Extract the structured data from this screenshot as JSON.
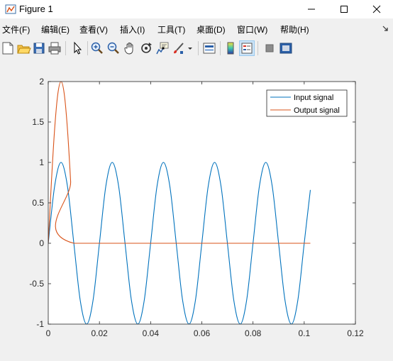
{
  "window": {
    "title": "Figure 1",
    "icon": "matlab-figure-icon",
    "controls": [
      "minimize-icon",
      "maximize-icon",
      "close-icon"
    ]
  },
  "menubar": {
    "items": [
      {
        "label": "文件(F)"
      },
      {
        "label": "编辑(E)"
      },
      {
        "label": "查看(V)"
      },
      {
        "label": "插入(I)"
      },
      {
        "label": "工具(T)"
      },
      {
        "label": "桌面(D)"
      },
      {
        "label": "窗口(W)"
      },
      {
        "label": "帮助(H)"
      }
    ],
    "dock_icon": "dock-arrow-icon"
  },
  "toolbar": {
    "buttons": [
      "new-figure-icon",
      "open-file-icon",
      "save-icon",
      "print-icon",
      "edit-plot-arrow-icon",
      "zoom-in-icon",
      "zoom-out-icon",
      "pan-hand-icon",
      "rotate-3d-icon",
      "data-cursor-icon",
      "brush-icon",
      "link-plot-icon",
      "colorbar-icon",
      "legend-icon",
      "hide-plot-tools-icon",
      "show-plot-tools-icon"
    ],
    "pressed": "legend-icon"
  },
  "chart_data": {
    "type": "line",
    "title": "",
    "xlabel": "",
    "ylabel": "",
    "xlim": [
      0,
      0.12
    ],
    "ylim": [
      -1,
      2
    ],
    "xticks": [
      "0",
      "0.02",
      "0.04",
      "0.06",
      "0.08",
      "0.1",
      "0.12"
    ],
    "yticks": [
      "-1",
      "-0.5",
      "0",
      "0.5",
      "1",
      "1.5",
      "2"
    ],
    "grid": false,
    "legend_position": "top-right",
    "series": [
      {
        "name": "Input signal",
        "color": "#0072bd",
        "x": [
          0,
          0.0025,
          0.005,
          0.0075,
          0.01,
          0.0125,
          0.015,
          0.0175,
          0.02,
          0.0225,
          0.025,
          0.0275,
          0.03,
          0.0325,
          0.035,
          0.0375,
          0.04,
          0.0425,
          0.045,
          0.0475,
          0.05,
          0.0525,
          0.055,
          0.0575,
          0.06,
          0.0625,
          0.065,
          0.0675,
          0.07,
          0.0725,
          0.075,
          0.0775,
          0.08,
          0.0825,
          0.085,
          0.0875,
          0.09,
          0.0925,
          0.095,
          0.0975,
          0.1,
          0.1024
        ],
        "y": [
          0,
          0.707,
          1,
          0.707,
          0,
          -0.707,
          -1,
          -0.707,
          0,
          0.707,
          1,
          0.707,
          0,
          -0.707,
          -1,
          -0.707,
          0,
          0.707,
          1,
          0.707,
          0,
          -0.707,
          -1,
          -0.707,
          0,
          0.707,
          1,
          0.707,
          0,
          -0.707,
          -1,
          -0.707,
          0,
          0.707,
          1,
          0.707,
          0,
          -0.707,
          -1,
          -0.707,
          0,
          0.66
        ]
      },
      {
        "name": "Output signal",
        "color": "#d95319",
        "x": [
          0,
          0.00125,
          0.0025,
          0.00375,
          0.005,
          0.00625,
          0.0075,
          0.00875,
          0.01,
          0.1024
        ],
        "y": [
          0,
          0.765,
          1.414,
          1.848,
          2,
          1.848,
          1.414,
          0.765,
          0,
          0
        ]
      }
    ]
  }
}
